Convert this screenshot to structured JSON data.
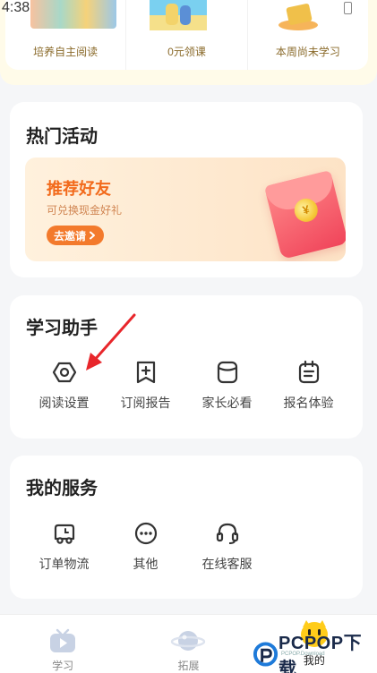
{
  "status": {
    "time": "4:38"
  },
  "top_cards": [
    {
      "label": "培养自主阅读"
    },
    {
      "label": "0元领课"
    },
    {
      "label": "本周尚未学习"
    }
  ],
  "activities": {
    "title": "热门活动",
    "banner": {
      "title": "推荐好友",
      "subtitle": "可兑换现金好礼",
      "button": "去邀请"
    }
  },
  "assistant": {
    "title": "学习助手",
    "items": [
      {
        "label": "阅读设置",
        "icon": "hexagon-settings-icon"
      },
      {
        "label": "订阅报告",
        "icon": "subscribe-report-icon"
      },
      {
        "label": "家长必看",
        "icon": "parent-guide-icon"
      },
      {
        "label": "报名体验",
        "icon": "signup-clipboard-icon"
      }
    ]
  },
  "services": {
    "title": "我的服务",
    "items": [
      {
        "label": "订单物流",
        "icon": "delivery-truck-icon"
      },
      {
        "label": "其他",
        "icon": "more-dots-icon"
      },
      {
        "label": "在线客服",
        "icon": "headset-icon"
      }
    ]
  },
  "tabbar": {
    "items": [
      {
        "label": "学习",
        "icon": "tv-play-icon"
      },
      {
        "label": "拓展",
        "icon": "planet-icon"
      },
      {
        "label": "我的",
        "icon": "mascot-icon"
      }
    ],
    "active": "我的"
  },
  "colors": {
    "accent": "#f37a2c",
    "banner_title": "#f26a1b",
    "annotation_arrow": "#e8262b",
    "top_area_bg": "#fffbe9"
  },
  "watermark": {
    "text": "PCPOP下载",
    "sub": "PCPOP.Download"
  }
}
